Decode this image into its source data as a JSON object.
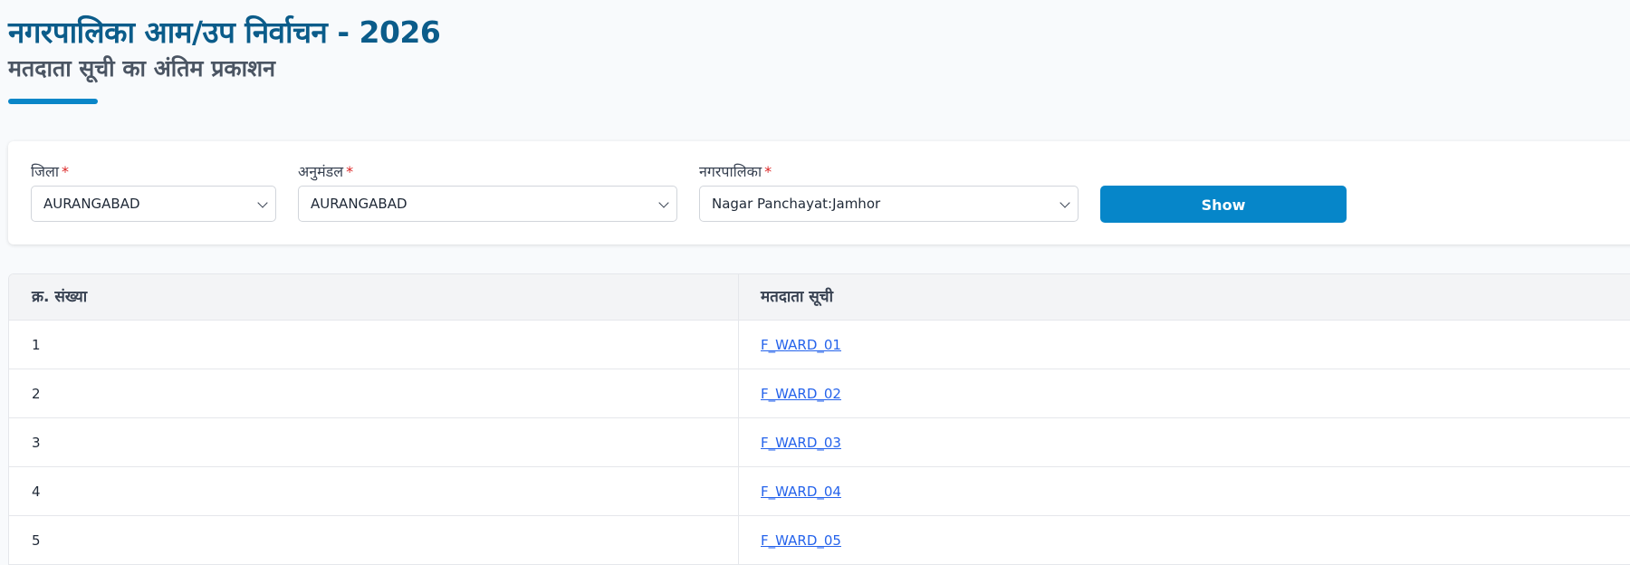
{
  "header": {
    "title": "नगरपालिका आम/उप निर्वाचन - 2026",
    "subtitle": "मतदाता सूची का अंतिम प्रकाशन"
  },
  "filters": {
    "district": {
      "label": "जिला",
      "required_mark": "*",
      "value": "AURANGABAD"
    },
    "subdivision": {
      "label": "अनुमंडल",
      "required_mark": "*",
      "value": "AURANGABAD"
    },
    "municipality": {
      "label": "नगरपालिका",
      "required_mark": "*",
      "value": "Nagar Panchayat:Jamhor"
    },
    "show_label": "Show"
  },
  "table": {
    "headers": [
      "क्र. संख्या",
      "मतदाता सूची"
    ],
    "rows": [
      {
        "serial": "1",
        "file": "F_WARD_01"
      },
      {
        "serial": "2",
        "file": "F_WARD_02"
      },
      {
        "serial": "3",
        "file": "F_WARD_03"
      },
      {
        "serial": "4",
        "file": "F_WARD_04"
      },
      {
        "serial": "5",
        "file": "F_WARD_05"
      }
    ]
  },
  "colors": {
    "title": "#0b5c8a",
    "accent": "#0686c9",
    "link": "#2563eb",
    "required": "#dc2626"
  }
}
